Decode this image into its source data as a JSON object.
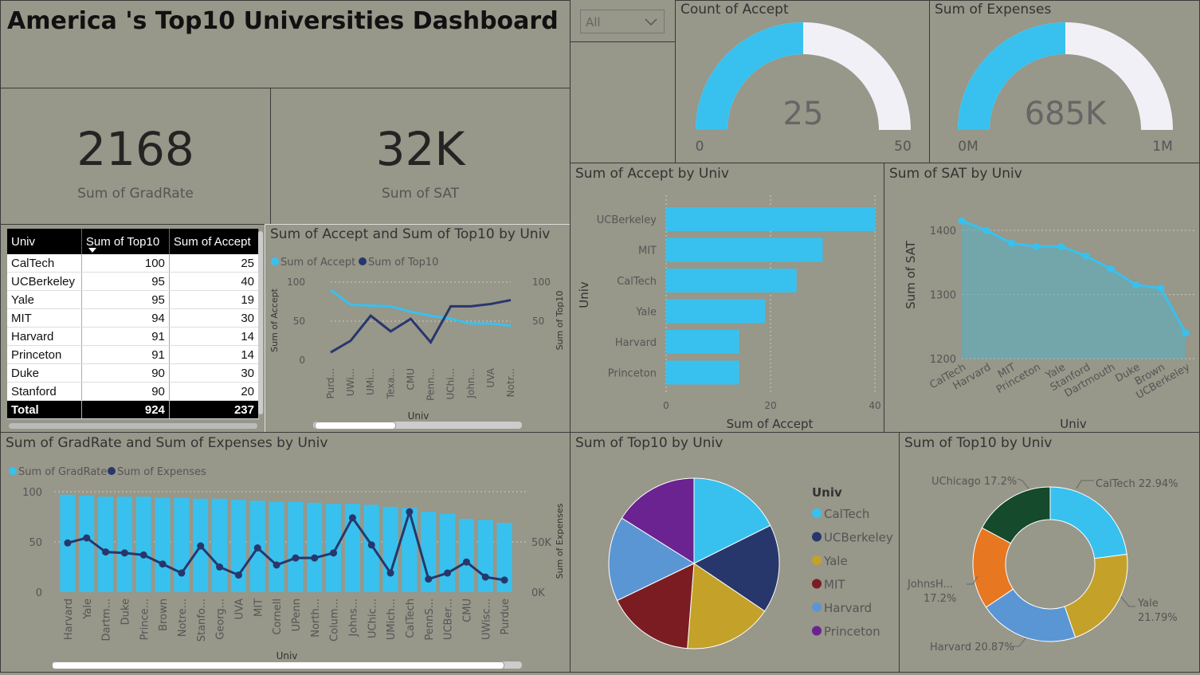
{
  "header": {
    "title": "America 's Top10 Universities Dashboard"
  },
  "slicer": {
    "value": "All"
  },
  "kpi1": {
    "value": "2168",
    "label": "Sum of GradRate"
  },
  "kpi2": {
    "value": "32K",
    "label": "Sum of SAT"
  },
  "gauge1": {
    "title": "Count of Accept",
    "value": "25",
    "min": "0",
    "max": "50",
    "fraction": 0.5
  },
  "gauge2": {
    "title": "Sum of Expenses",
    "value": "685K",
    "min": "0M",
    "max": "1M",
    "fraction": 0.5
  },
  "table": {
    "headers": [
      "Univ",
      "Sum of Top10",
      "Sum of Accept"
    ],
    "rows": [
      [
        "CalTech",
        "100",
        "25"
      ],
      [
        "UCBerkeley",
        "95",
        "40"
      ],
      [
        "Yale",
        "95",
        "19"
      ],
      [
        "MIT",
        "94",
        "30"
      ],
      [
        "Harvard",
        "91",
        "14"
      ],
      [
        "Princeton",
        "91",
        "14"
      ],
      [
        "Duke",
        "90",
        "30"
      ],
      [
        "Stanford",
        "90",
        "20"
      ]
    ],
    "total": [
      "Total",
      "924",
      "237"
    ]
  },
  "colors": {
    "light": "#38c1ee",
    "dark": "#28376b",
    "bg": "#97978a"
  },
  "chart_data": [
    {
      "id": "accept_top10_line",
      "type": "line",
      "title": "Sum of Accept and Sum of Top10 by Univ",
      "xlabel": "Univ",
      "ylabel": "Sum of Accept",
      "y2label": "Sum of Top10",
      "categories": [
        "Purd...",
        "UWi...",
        "UMi...",
        "Texa...",
        "CMU",
        "Penn...",
        "UChi...",
        "John...",
        "UVA",
        "Notr..."
      ],
      "ylim": [
        0,
        100
      ],
      "y2lim": [
        0,
        100
      ],
      "yticks": [
        "0",
        "50",
        "100"
      ],
      "y2ticks": [
        "50",
        "100"
      ],
      "series": [
        {
          "name": "Sum of Accept",
          "color": "#38c1ee",
          "values": [
            90,
            71,
            70,
            69,
            62,
            57,
            53,
            47,
            47,
            44
          ]
        },
        {
          "name": "Sum of Top10",
          "color": "#28376b",
          "values": [
            10,
            25,
            57,
            37,
            53,
            23,
            69,
            69,
            72,
            77
          ]
        }
      ]
    },
    {
      "id": "accept_bar",
      "type": "bar",
      "title": "Sum of Accept by Univ",
      "xlabel": "Sum of Accept",
      "ylabel": "Univ",
      "categories": [
        "UCBerkeley",
        "MIT",
        "CalTech",
        "Yale",
        "Harvard",
        "Princeton"
      ],
      "values": [
        40,
        30,
        25,
        19,
        14,
        14
      ],
      "xlim": [
        0,
        40
      ],
      "xticks": [
        "0",
        "20",
        "40"
      ]
    },
    {
      "id": "sat_area",
      "type": "area",
      "title": "Sum of SAT by Univ",
      "xlabel": "Univ",
      "ylabel": "Sum of SAT",
      "categories": [
        "CalTech",
        "Harvard",
        "MIT",
        "Princeton",
        "Yale",
        "Stanford",
        "Dartmouth",
        "Duke",
        "Brown",
        "UCBerkeley"
      ],
      "values": [
        1415,
        1400,
        1380,
        1375,
        1375,
        1360,
        1340,
        1315,
        1310,
        1240
      ],
      "ylim": [
        1200,
        1430
      ],
      "yticks": [
        "1200",
        "1300",
        "1400"
      ]
    },
    {
      "id": "gradrate_expenses",
      "type": "bar",
      "title": "Sum of GradRate and Sum of Expenses by Univ",
      "xlabel": "Univ",
      "y2label": "Sum of Expenses",
      "categories": [
        "Harvard",
        "Yale",
        "Dartm...",
        "Duke",
        "Prince...",
        "Brown",
        "Notre...",
        "Stanfo...",
        "Georg...",
        "UVA",
        "MIT",
        "Cornell",
        "UPenn",
        "North...",
        "Colum...",
        "Johns...",
        "UChic...",
        "UMich...",
        "CalTech",
        "PennS...",
        "UCBer...",
        "CMU",
        "UWisc...",
        "Purdue"
      ],
      "ylim": [
        0,
        100
      ],
      "y2lim": [
        0,
        100000
      ],
      "yticks": [
        "0",
        "50",
        "100"
      ],
      "y2ticks": [
        "0K",
        "50K"
      ],
      "series": [
        {
          "name": "Sum of GradRate",
          "color": "#38c1ee",
          "values": [
            97,
            96,
            95,
            95,
            95,
            94,
            94,
            93,
            93,
            92,
            91,
            90,
            90,
            89,
            88,
            88,
            87,
            85,
            84,
            80,
            78,
            73,
            72,
            69
          ]
        },
        {
          "name": "Sum of Expenses",
          "color": "#28376b",
          "values": [
            49000,
            54000,
            40000,
            39000,
            37000,
            28000,
            19000,
            46000,
            25000,
            17000,
            44000,
            27000,
            34000,
            34000,
            39000,
            74000,
            47000,
            19000,
            80000,
            13000,
            19000,
            30000,
            15000,
            12000
          ]
        }
      ]
    },
    {
      "id": "top10_pie",
      "type": "pie",
      "title": "Sum of Top10 by Univ",
      "legend_title": "Univ",
      "categories": [
        "CalTech",
        "UCBerkeley",
        "Yale",
        "MIT",
        "Harvard",
        "Princeton"
      ],
      "values": [
        100,
        95,
        95,
        94,
        91,
        91
      ],
      "colors": [
        "#38c1ee",
        "#28376b",
        "#c4a128",
        "#7b1c23",
        "#5b96d4",
        "#6a2390"
      ]
    },
    {
      "id": "top10_donut",
      "type": "pie",
      "title": "Sum of Top10 by Univ",
      "categories": [
        "CalTech",
        "Yale",
        "Harvard",
        "JohnsH...",
        "UChicago"
      ],
      "values": [
        22.94,
        21.79,
        20.87,
        17.2,
        17.2
      ],
      "labels": [
        "CalTech 22.94%",
        "Yale 21.79%",
        "Harvard 20.87%",
        "JohnsH... 17.2%",
        "UChicago 17.2%"
      ],
      "colors": [
        "#38c1ee",
        "#c4a128",
        "#5b96d4",
        "#e87722",
        "#154a2c"
      ]
    }
  ]
}
